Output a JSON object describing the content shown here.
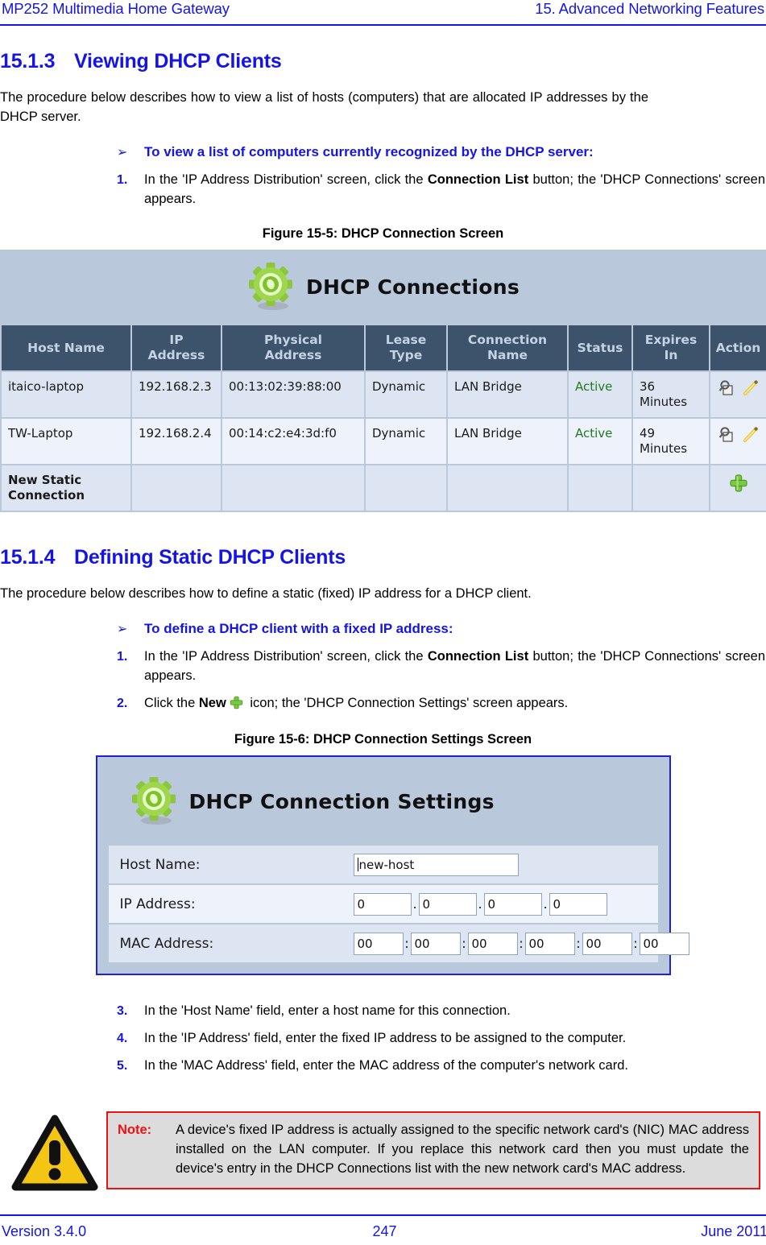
{
  "header": {
    "left": "MP252 Multimedia Home Gateway",
    "right": "15. Advanced Networking Features"
  },
  "sections": [
    {
      "number": "15.1.3",
      "title": "Viewing DHCP Clients",
      "intro": "The procedure below describes how to view a list of hosts (computers) that are allocated IP addresses by the DHCP server.",
      "arrow_head": "To view a list of computers currently recognized by the DHCP server:",
      "arrow_glyph": "➢",
      "steps": [
        {
          "num": "1.",
          "pre": "In the 'IP Address Distribution' screen, click the ",
          "bold": "Connection List",
          "post": " button; the 'DHCP Connections' screen appears."
        }
      ]
    },
    {
      "number": "15.1.4",
      "title": "Defining Static DHCP Clients",
      "intro": "The procedure below describes how to define a static (fixed) IP address for a DHCP client.",
      "arrow_head": "To define a DHCP client with a fixed IP address:",
      "arrow_glyph": "➢",
      "steps": [
        {
          "num": "1.",
          "pre": "In the 'IP Address Distribution' screen, click the ",
          "bold": "Connection List",
          "post": " button; the 'DHCP Connections' screen appears."
        },
        {
          "num": "2.",
          "pre": "Click the ",
          "bold": "New",
          "post": " icon; the 'DHCP Connection Settings' screen appears.",
          "has_plus_icon": true
        }
      ]
    }
  ],
  "figure1": {
    "caption": "Figure 15-5: DHCP Connection Screen",
    "ui_title": "DHCP Connections",
    "columns": [
      "Host Name",
      "IP\nAddress",
      "Physical\nAddress",
      "Lease\nType",
      "Connection\nName",
      "Status",
      "Expires\nIn",
      "Action"
    ],
    "rows": [
      {
        "host_name": "itaico-laptop",
        "ip_address": "192.168.2.3",
        "physical_address": "00:13:02:39:88:00",
        "lease_type": "Dynamic",
        "connection_name": "LAN Bridge",
        "status": "Active",
        "expires_in": "36 Minutes",
        "actions": [
          "view-icon",
          "edit-icon",
          "delete-icon"
        ]
      },
      {
        "host_name": "TW-Laptop",
        "ip_address": "192.168.2.4",
        "physical_address": "00:14:c2:e4:3d:f0",
        "lease_type": "Dynamic",
        "connection_name": "LAN Bridge",
        "status": "Active",
        "expires_in": "49 Minutes",
        "actions": [
          "view-icon",
          "edit-icon",
          "delete-icon"
        ]
      }
    ],
    "new_static_label": "New Static\nConnection",
    "new_static_icon": "plus-icon"
  },
  "figure2": {
    "caption": "Figure 15-6: DHCP Connection Settings Screen",
    "ui_title": "DHCP Connection Settings",
    "fields": {
      "host_name_label": "Host Name:",
      "host_name_value": "new-host",
      "ip_address_label": "IP Address:",
      "ip_address_octets": [
        "0",
        "0",
        "0",
        "0"
      ],
      "ip_separator": ".",
      "mac_address_label": "MAC Address:",
      "mac_address_pairs": [
        "00",
        "00",
        "00",
        "00",
        "00",
        "00"
      ],
      "mac_separator": ":"
    }
  },
  "later_steps": [
    {
      "num": "3.",
      "text": "In the 'Host Name' field, enter a host name for this connection."
    },
    {
      "num": "4.",
      "text": "In the 'IP Address' field, enter the fixed IP address to be assigned to the computer."
    },
    {
      "num": "5.",
      "text": "In the 'MAC Address' field, enter the MAC address of the computer's network card."
    }
  ],
  "note": {
    "label": "Note:",
    "text": "A device's fixed IP address is actually assigned to the specific network card's (NIC) MAC address installed on the LAN computer. If you replace this network card then you must update the device's entry in the DHCP Connections list with the new network card's MAC address."
  },
  "footer": {
    "version": "Version 3.4.0",
    "page": "247",
    "date": "June 2011"
  },
  "colors": {
    "doc_blue": "#1414e6",
    "ui_background": "#b9c8da",
    "table_header": "#3d536b",
    "status_green": "#207a20",
    "note_red": "#ee1111",
    "warn_yellow": "#f5c513"
  }
}
